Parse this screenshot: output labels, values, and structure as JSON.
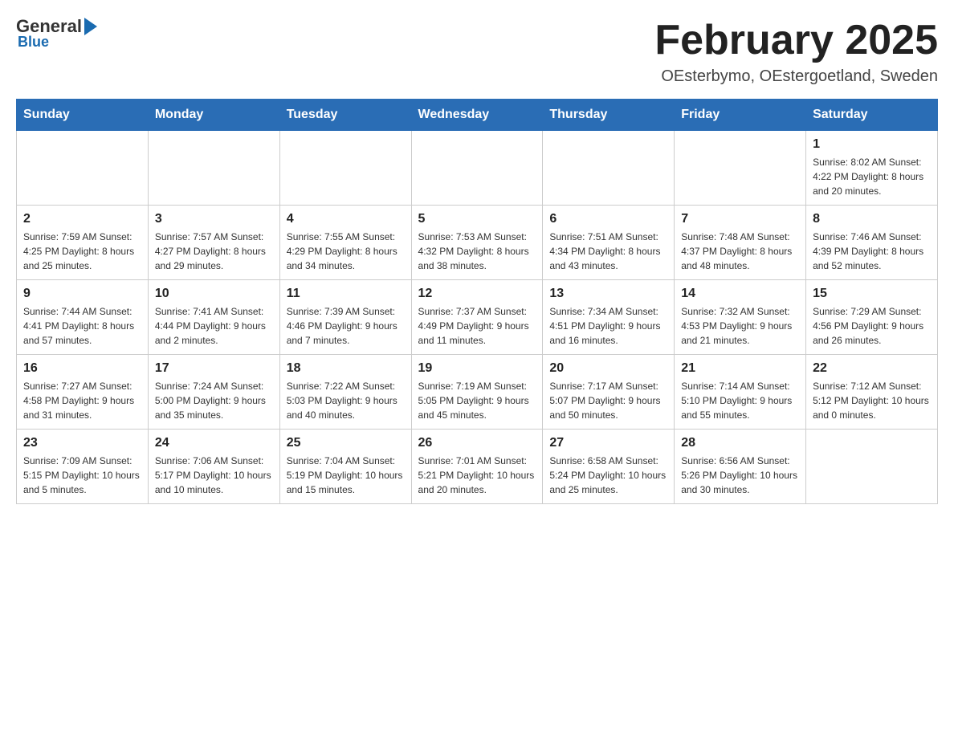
{
  "header": {
    "logo": {
      "part1": "General",
      "part2": "Blue"
    },
    "title": "February 2025",
    "location": "OEsterbymo, OEstergoetland, Sweden"
  },
  "days_of_week": [
    "Sunday",
    "Monday",
    "Tuesday",
    "Wednesday",
    "Thursday",
    "Friday",
    "Saturday"
  ],
  "weeks": [
    {
      "days": [
        {
          "num": "",
          "info": ""
        },
        {
          "num": "",
          "info": ""
        },
        {
          "num": "",
          "info": ""
        },
        {
          "num": "",
          "info": ""
        },
        {
          "num": "",
          "info": ""
        },
        {
          "num": "",
          "info": ""
        },
        {
          "num": "1",
          "info": "Sunrise: 8:02 AM\nSunset: 4:22 PM\nDaylight: 8 hours and 20 minutes."
        }
      ]
    },
    {
      "days": [
        {
          "num": "2",
          "info": "Sunrise: 7:59 AM\nSunset: 4:25 PM\nDaylight: 8 hours and 25 minutes."
        },
        {
          "num": "3",
          "info": "Sunrise: 7:57 AM\nSunset: 4:27 PM\nDaylight: 8 hours and 29 minutes."
        },
        {
          "num": "4",
          "info": "Sunrise: 7:55 AM\nSunset: 4:29 PM\nDaylight: 8 hours and 34 minutes."
        },
        {
          "num": "5",
          "info": "Sunrise: 7:53 AM\nSunset: 4:32 PM\nDaylight: 8 hours and 38 minutes."
        },
        {
          "num": "6",
          "info": "Sunrise: 7:51 AM\nSunset: 4:34 PM\nDaylight: 8 hours and 43 minutes."
        },
        {
          "num": "7",
          "info": "Sunrise: 7:48 AM\nSunset: 4:37 PM\nDaylight: 8 hours and 48 minutes."
        },
        {
          "num": "8",
          "info": "Sunrise: 7:46 AM\nSunset: 4:39 PM\nDaylight: 8 hours and 52 minutes."
        }
      ]
    },
    {
      "days": [
        {
          "num": "9",
          "info": "Sunrise: 7:44 AM\nSunset: 4:41 PM\nDaylight: 8 hours and 57 minutes."
        },
        {
          "num": "10",
          "info": "Sunrise: 7:41 AM\nSunset: 4:44 PM\nDaylight: 9 hours and 2 minutes."
        },
        {
          "num": "11",
          "info": "Sunrise: 7:39 AM\nSunset: 4:46 PM\nDaylight: 9 hours and 7 minutes."
        },
        {
          "num": "12",
          "info": "Sunrise: 7:37 AM\nSunset: 4:49 PM\nDaylight: 9 hours and 11 minutes."
        },
        {
          "num": "13",
          "info": "Sunrise: 7:34 AM\nSunset: 4:51 PM\nDaylight: 9 hours and 16 minutes."
        },
        {
          "num": "14",
          "info": "Sunrise: 7:32 AM\nSunset: 4:53 PM\nDaylight: 9 hours and 21 minutes."
        },
        {
          "num": "15",
          "info": "Sunrise: 7:29 AM\nSunset: 4:56 PM\nDaylight: 9 hours and 26 minutes."
        }
      ]
    },
    {
      "days": [
        {
          "num": "16",
          "info": "Sunrise: 7:27 AM\nSunset: 4:58 PM\nDaylight: 9 hours and 31 minutes."
        },
        {
          "num": "17",
          "info": "Sunrise: 7:24 AM\nSunset: 5:00 PM\nDaylight: 9 hours and 35 minutes."
        },
        {
          "num": "18",
          "info": "Sunrise: 7:22 AM\nSunset: 5:03 PM\nDaylight: 9 hours and 40 minutes."
        },
        {
          "num": "19",
          "info": "Sunrise: 7:19 AM\nSunset: 5:05 PM\nDaylight: 9 hours and 45 minutes."
        },
        {
          "num": "20",
          "info": "Sunrise: 7:17 AM\nSunset: 5:07 PM\nDaylight: 9 hours and 50 minutes."
        },
        {
          "num": "21",
          "info": "Sunrise: 7:14 AM\nSunset: 5:10 PM\nDaylight: 9 hours and 55 minutes."
        },
        {
          "num": "22",
          "info": "Sunrise: 7:12 AM\nSunset: 5:12 PM\nDaylight: 10 hours and 0 minutes."
        }
      ]
    },
    {
      "days": [
        {
          "num": "23",
          "info": "Sunrise: 7:09 AM\nSunset: 5:15 PM\nDaylight: 10 hours and 5 minutes."
        },
        {
          "num": "24",
          "info": "Sunrise: 7:06 AM\nSunset: 5:17 PM\nDaylight: 10 hours and 10 minutes."
        },
        {
          "num": "25",
          "info": "Sunrise: 7:04 AM\nSunset: 5:19 PM\nDaylight: 10 hours and 15 minutes."
        },
        {
          "num": "26",
          "info": "Sunrise: 7:01 AM\nSunset: 5:21 PM\nDaylight: 10 hours and 20 minutes."
        },
        {
          "num": "27",
          "info": "Sunrise: 6:58 AM\nSunset: 5:24 PM\nDaylight: 10 hours and 25 minutes."
        },
        {
          "num": "28",
          "info": "Sunrise: 6:56 AM\nSunset: 5:26 PM\nDaylight: 10 hours and 30 minutes."
        },
        {
          "num": "",
          "info": ""
        }
      ]
    }
  ]
}
